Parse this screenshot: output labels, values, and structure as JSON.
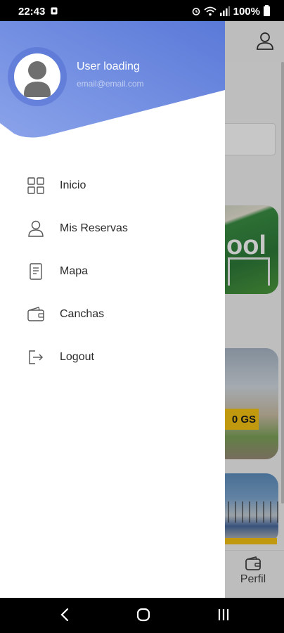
{
  "status_bar": {
    "time": "22:43",
    "battery": "100%"
  },
  "drawer": {
    "user_name": "User loading",
    "user_email": "email@email.com",
    "header_colors": {
      "start": "#5a79d8",
      "end": "#8aa3ea"
    },
    "menu": [
      {
        "label": "Inicio",
        "icon": "grid-icon"
      },
      {
        "label": "Mis Reservas",
        "icon": "user-icon"
      },
      {
        "label": "Mapa",
        "icon": "document-icon"
      },
      {
        "label": "Canchas",
        "icon": "wallet-icon"
      },
      {
        "label": "Logout",
        "icon": "logout-icon"
      }
    ]
  },
  "background": {
    "card1_text": "ool",
    "price_badge": "0 GS",
    "bottom_nav": {
      "perfil_label": "Perfil"
    }
  },
  "system_nav": {
    "back": "back-icon",
    "home": "home-icon",
    "recents": "recents-icon"
  }
}
